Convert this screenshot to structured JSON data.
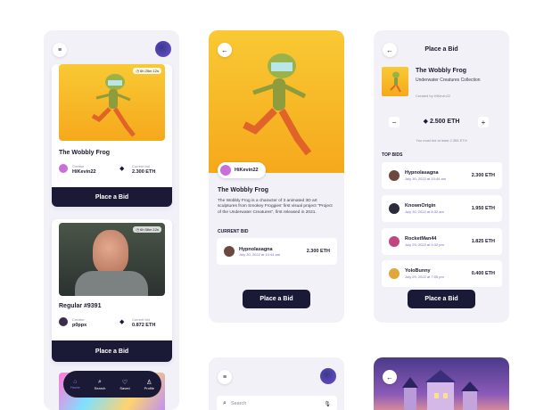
{
  "screen1": {
    "card1": {
      "timer": "6h 25m 12s",
      "title": "The Wobbly Frog",
      "creator_label": "Creator",
      "creator_name": "HiKevin22",
      "bid_label": "Current bid",
      "bid_value": "2.300 ETH",
      "button": "Place a Bid"
    },
    "card2": {
      "timer": "6h 56m 12s",
      "title": "Regular #9391",
      "creator_label": "Creator",
      "creator_name": "p0ppx",
      "bid_label": "Current bid",
      "bid_value": "0.872 ETH",
      "button": "Place a Bid"
    },
    "tabbar": [
      "Home",
      "Search",
      "Saved",
      "Profile"
    ]
  },
  "screen2": {
    "creator_name": "HiKevin22",
    "title": "The Wobbly Frog",
    "description": "The Wobbly Frog is a character of 3 animated 3D art sculptures from Smokey Froggies' first visual project \"Project of the Underwater Creatures\", first released in 2021.",
    "current_bid_label": "CURRENT BID",
    "bidder_name": "Hypnolasagna",
    "bidder_date": "July 30, 2022 at 10:44 am",
    "bid_value": "2.300 ETH",
    "button": "Place a Bid"
  },
  "screen3": {
    "header_title": "Place a Bid",
    "nft_title": "The Wobbly Frog",
    "nft_collection": "Underwater Creatures Collection",
    "nft_creator": "Created by HiKevin22",
    "minus": "−",
    "plus": "+",
    "amount": "2.500 ETH",
    "min_note": "You must bid at least 2.355 ETH",
    "top_bids_label": "TOP BIDS",
    "bids": [
      {
        "name": "Hypnolasagna",
        "date": "July 30, 2022 at 10:44 am",
        "amount": "2.300 ETH"
      },
      {
        "name": "KnownOrigin",
        "date": "July 30, 2022 at 8:32 am",
        "amount": "1.950 ETH"
      },
      {
        "name": "RocketMan44",
        "date": "July 29, 2022 at 9:32 pm",
        "amount": "1.825 ETH"
      },
      {
        "name": "YoloBunny",
        "date": "July 29, 2022 at 7:05 pm",
        "amount": "0.400 ETH"
      }
    ],
    "button": "Place a Bid"
  },
  "screen4": {
    "search_placeholder": "Search"
  },
  "colors": {
    "accent": "#f5b21f",
    "navy": "#1b1a36",
    "purple": "#7a67c7",
    "panel": "#f2f1f8"
  }
}
